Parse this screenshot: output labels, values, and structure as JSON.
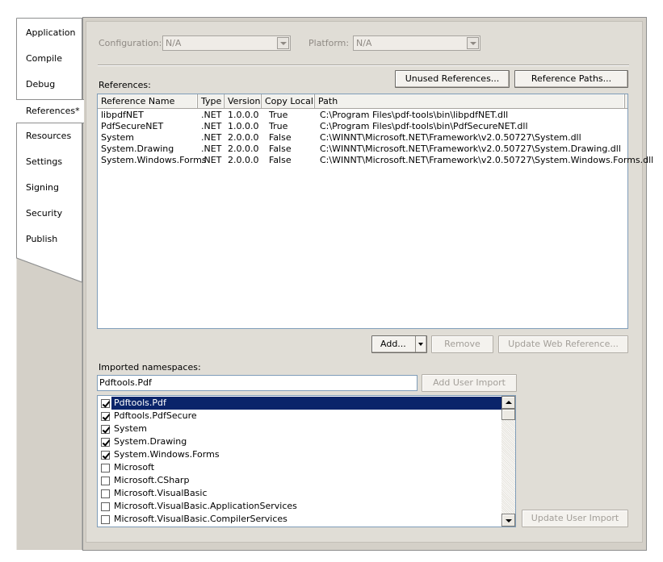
{
  "tabs": [
    {
      "label": "Application"
    },
    {
      "label": "Compile"
    },
    {
      "label": "Debug"
    },
    {
      "label": "References*",
      "active": true
    },
    {
      "label": "Resources"
    },
    {
      "label": "Settings"
    },
    {
      "label": "Signing"
    },
    {
      "label": "Security"
    },
    {
      "label": "Publish"
    }
  ],
  "config": {
    "configuration_label": "Configuration:",
    "configuration_value": "N/A",
    "platform_label": "Platform:",
    "platform_value": "N/A"
  },
  "references": {
    "label": "References:",
    "unused_button": "Unused References...",
    "paths_button": "Reference Paths...",
    "columns": [
      "Reference Name",
      "Type",
      "Version",
      "Copy Local",
      "Path"
    ],
    "rows": [
      {
        "name": "libpdfNET",
        "type": ".NET",
        "version": "1.0.0.0",
        "copy_local": "True",
        "path": "C:\\Program Files\\pdf-tools\\bin\\libpdfNET.dll"
      },
      {
        "name": "PdfSecureNET",
        "type": ".NET",
        "version": "1.0.0.0",
        "copy_local": "True",
        "path": "C:\\Program Files\\pdf-tools\\bin\\PdfSecureNET.dll"
      },
      {
        "name": "System",
        "type": ".NET",
        "version": "2.0.0.0",
        "copy_local": "False",
        "path": "C:\\WINNT\\Microsoft.NET\\Framework\\v2.0.50727\\System.dll"
      },
      {
        "name": "System.Drawing",
        "type": ".NET",
        "version": "2.0.0.0",
        "copy_local": "False",
        "path": "C:\\WINNT\\Microsoft.NET\\Framework\\v2.0.50727\\System.Drawing.dll"
      },
      {
        "name": "System.Windows.Forms",
        "type": ".NET",
        "version": "2.0.0.0",
        "copy_local": "False",
        "path": "C:\\WINNT\\Microsoft.NET\\Framework\\v2.0.50727\\System.Windows.Forms.dll"
      }
    ],
    "add_button": "Add...",
    "remove_button": "Remove",
    "update_web_button": "Update Web Reference..."
  },
  "namespaces": {
    "label": "Imported namespaces:",
    "input_value": "Pdftools.Pdf",
    "add_user_import_button": "Add User Import",
    "update_user_import_button": "Update User Import",
    "items": [
      {
        "label": "Pdftools.Pdf",
        "checked": true,
        "selected": true
      },
      {
        "label": "Pdftools.PdfSecure",
        "checked": true
      },
      {
        "label": "System",
        "checked": true
      },
      {
        "label": "System.Drawing",
        "checked": true
      },
      {
        "label": "System.Windows.Forms",
        "checked": true
      },
      {
        "label": "Microsoft",
        "checked": false
      },
      {
        "label": "Microsoft.CSharp",
        "checked": false
      },
      {
        "label": "Microsoft.VisualBasic",
        "checked": false
      },
      {
        "label": "Microsoft.VisualBasic.ApplicationServices",
        "checked": false
      },
      {
        "label": "Microsoft.VisualBasic.CompilerServices",
        "checked": false
      }
    ]
  },
  "icons": {
    "dropdown": "chevron-down-icon",
    "scroll_up": "arrow-up-icon",
    "scroll_down": "arrow-down-icon",
    "checkbox": "checkbox-icon"
  },
  "colors": {
    "selection": "#0a246a",
    "panel": "#d4d0c8",
    "list_border": "#7f9db9"
  }
}
